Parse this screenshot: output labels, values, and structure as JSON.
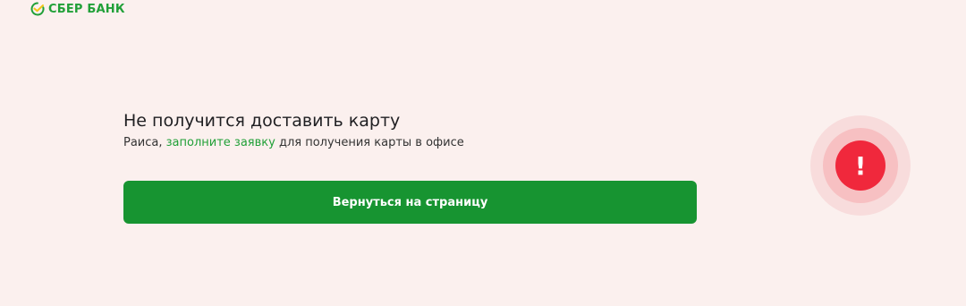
{
  "header": {
    "logo_text": "СБЕР БАНК",
    "logo_icon": "sber-checkmark-icon"
  },
  "message": {
    "title": "Не получится доставить карту",
    "subtitle_prefix": "Раиса, ",
    "subtitle_link": "заполните заявку",
    "subtitle_suffix": " для получения карты в офисе"
  },
  "actions": {
    "back_label": "Вернуться на страницу"
  },
  "alert": {
    "icon": "exclamation-icon",
    "glyph": "!"
  },
  "colors": {
    "background": "#fbf0ee",
    "brand": "#21a038",
    "button": "#179431",
    "alert": "#f0283c"
  }
}
